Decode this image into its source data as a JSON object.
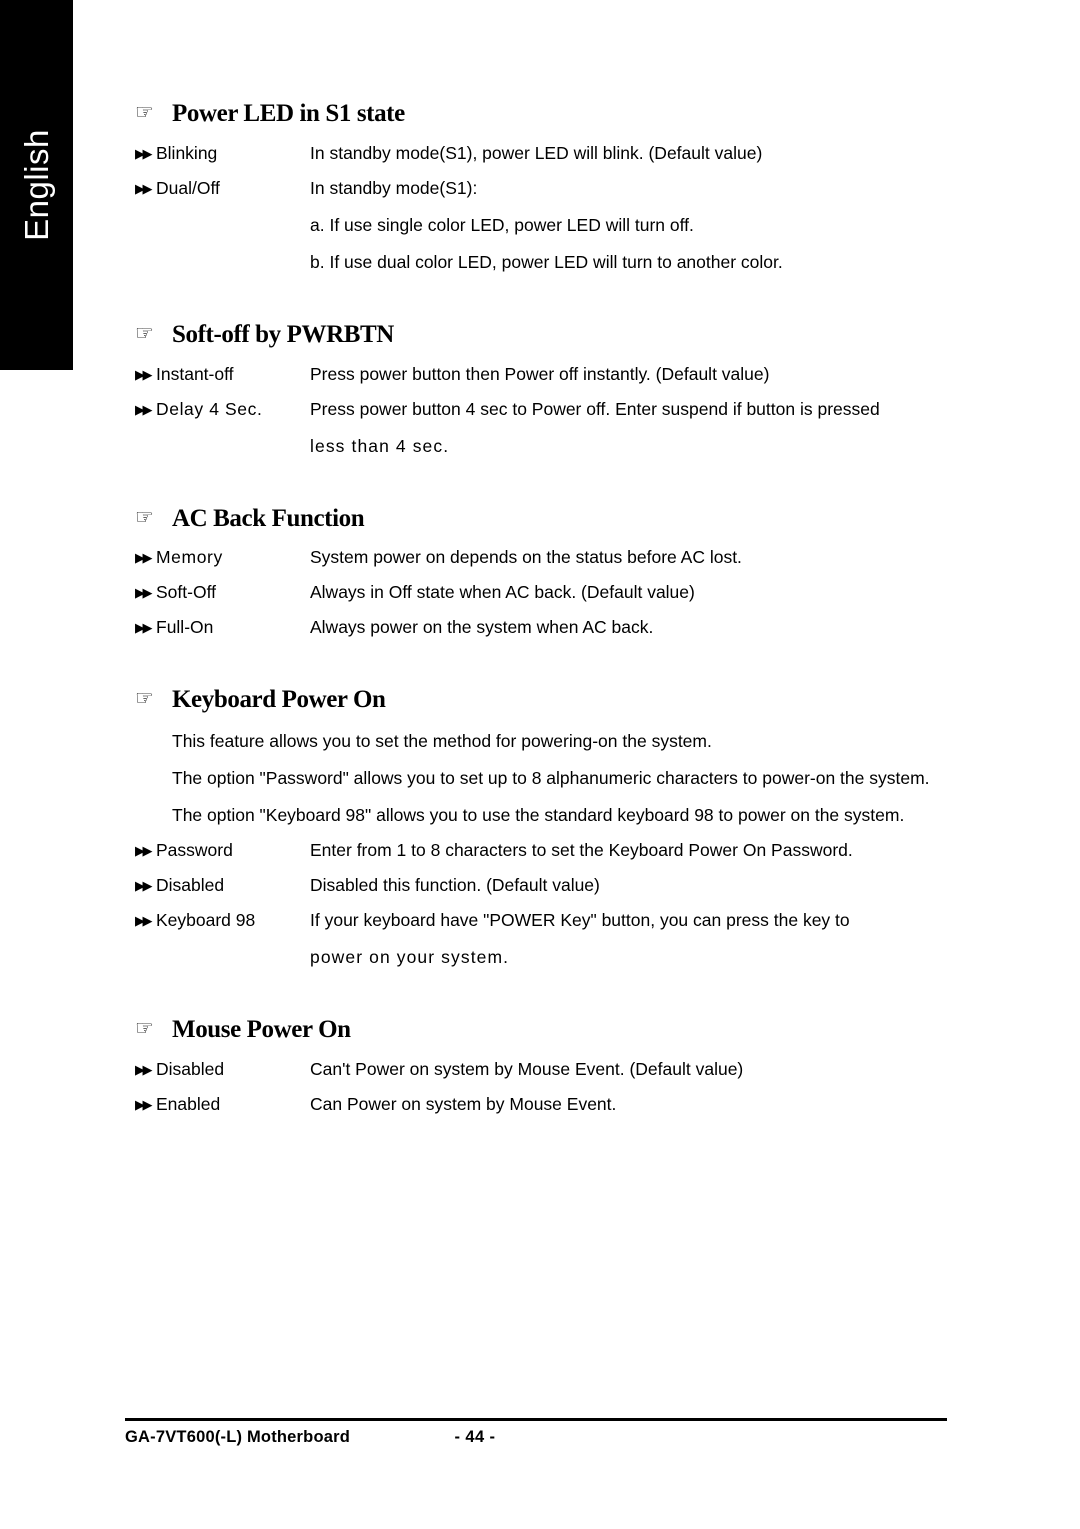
{
  "language_tab": {
    "label": "English"
  },
  "icons": {
    "hand": "☞",
    "double_triangle": "▶▶"
  },
  "sections": [
    {
      "id": "power-led-s1",
      "heading": "Power LED in S1 state",
      "options": [
        {
          "label": "Blinking",
          "desc": "In standby mode(S1), power LED will blink. (Default value)",
          "cont": []
        },
        {
          "label": "Dual/Off",
          "desc": "In standby mode(S1):",
          "cont": [
            "a. If use single color LED, power LED will turn off.",
            "b. If use dual color LED, power LED will turn to another color."
          ]
        }
      ],
      "paragraphs": []
    },
    {
      "id": "soft-off-pwrbtn",
      "heading": "Soft-off by PWRBTN",
      "options": [
        {
          "label": "Instant-off",
          "desc": "Press power button then Power off instantly. (Default value)",
          "cont": []
        },
        {
          "label": "Delay 4 Sec.",
          "desc": "Press power button 4 sec to Power off. Enter suspend if button is pressed",
          "cont": [
            "less than 4 sec."
          ]
        }
      ],
      "paragraphs": []
    },
    {
      "id": "ac-back-function",
      "heading": "AC Back Function",
      "options": [
        {
          "label": "Memory",
          "desc": "System power on depends on the status before AC lost.",
          "cont": []
        },
        {
          "label": "Soft-Off",
          "desc": "Always in Off state when AC back. (Default value)",
          "cont": []
        },
        {
          "label": "Full-On",
          "desc": "Always power on the system when AC back.",
          "cont": []
        }
      ],
      "paragraphs": []
    },
    {
      "id": "keyboard-power-on",
      "heading": "Keyboard Power On",
      "paragraphs": [
        "This feature allows you to set the method for powering-on the system.",
        "The option \"Password\" allows you to set up to 8 alphanumeric characters to power-on the system.",
        "The option \"Keyboard 98\" allows you to use the standard keyboard 98 to power on the system."
      ],
      "options": [
        {
          "label": "Password",
          "desc": "Enter from 1 to 8 characters to set the Keyboard Power On Password.",
          "cont": []
        },
        {
          "label": "Disabled",
          "desc": "Disabled this function. (Default value)",
          "cont": []
        },
        {
          "label": "Keyboard 98",
          "desc": "If your keyboard have \"POWER Key\" button, you can press the key to",
          "cont": [
            "power on your system."
          ]
        }
      ]
    },
    {
      "id": "mouse-power-on",
      "heading": "Mouse Power On",
      "paragraphs": [],
      "options": [
        {
          "label": "Disabled",
          "desc": "Can't Power on system by Mouse Event. (Default value)",
          "cont": []
        },
        {
          "label": "Enabled",
          "desc": "Can Power on system by Mouse Event.",
          "cont": []
        }
      ]
    }
  ],
  "footer": {
    "product": "GA-7VT600(-L) Motherboard",
    "page_number": "- 44 -"
  }
}
